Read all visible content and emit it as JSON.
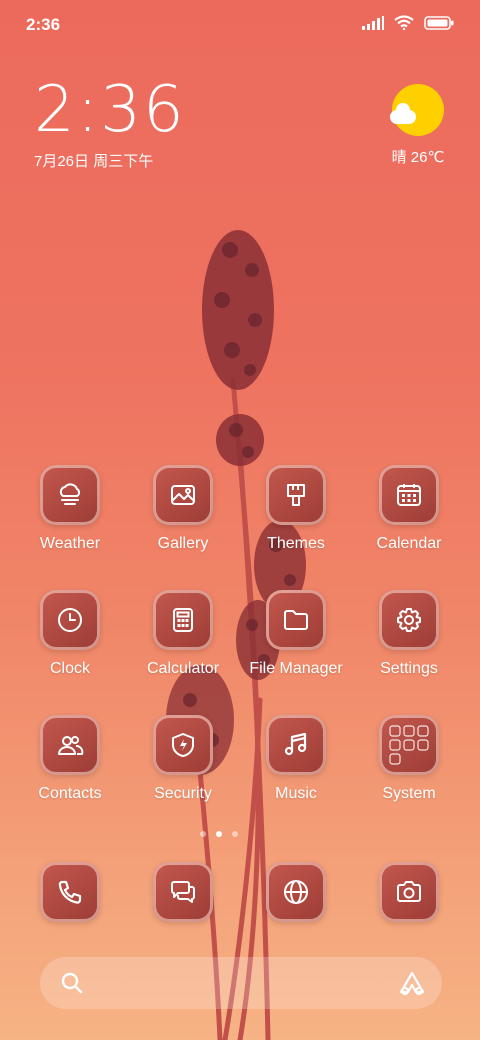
{
  "status_bar": {
    "time": "2:36",
    "signal_icon": "signal-icon",
    "wifi_icon": "wifi-icon",
    "battery_icon": "battery-icon"
  },
  "clock_widget": {
    "time": "2:36",
    "date": "7月26日 周三下午"
  },
  "weather_widget": {
    "icon": "sunny-cloud-icon",
    "text": "晴 26℃",
    "sun_color": "#ffd000"
  },
  "apps": [
    {
      "label": "Weather",
      "icon": "weather-icon"
    },
    {
      "label": "Gallery",
      "icon": "gallery-icon"
    },
    {
      "label": "Themes",
      "icon": "themes-icon"
    },
    {
      "label": "Calendar",
      "icon": "calendar-icon"
    },
    {
      "label": "Clock",
      "icon": "clock-icon"
    },
    {
      "label": "Calculator",
      "icon": "calculator-icon"
    },
    {
      "label": "File Manager",
      "icon": "folder-icon"
    },
    {
      "label": "Settings",
      "icon": "gear-icon"
    },
    {
      "label": "Contacts",
      "icon": "contacts-icon"
    },
    {
      "label": "Security",
      "icon": "shield-icon"
    },
    {
      "label": "Music",
      "icon": "music-icon"
    },
    {
      "label": "System",
      "icon": "folder-grid-icon"
    }
  ],
  "page_indicator": {
    "pages": 3,
    "active": 2
  },
  "dock": [
    {
      "icon": "phone-icon"
    },
    {
      "icon": "messages-icon"
    },
    {
      "icon": "browser-icon"
    },
    {
      "icon": "camera-icon"
    }
  ],
  "search_bar": {
    "left_icon": "search-icon",
    "right_icon": "app-vault-icon"
  },
  "colors": {
    "background_top": "#ec6a5c",
    "background_bottom": "#f6b384",
    "tile": "#b04a42"
  }
}
